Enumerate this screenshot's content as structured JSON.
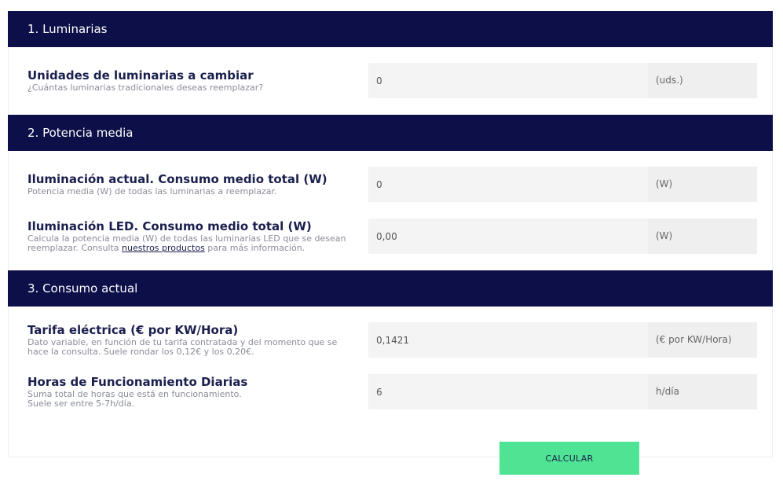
{
  "sections": [
    {
      "header": "1. Luminarias",
      "rows": [
        {
          "title": "Unidades de luminarias a cambiar",
          "description": "¿Cuántas luminarias tradicionales deseas reemplazar?",
          "value": "0",
          "unit": "(uds.)"
        }
      ]
    },
    {
      "header": "2. Potencia media",
      "rows": [
        {
          "title": "Iluminación actual. Consumo medio total (W)",
          "description": "Potencia media (W) de todas las luminarias a reemplazar.",
          "value": "0",
          "unit": "(W)"
        },
        {
          "title": "Iluminación LED. Consumo medio total (W)",
          "description_before": "Calcula la potencia media (W) de todas las luminarias LED que se desean reemplazar. Consulta ",
          "description_link": "nuestros productos",
          "description_after": " para más información.",
          "value": "0,00",
          "unit": "(W)"
        }
      ]
    },
    {
      "header": "3. Consumo actual",
      "rows": [
        {
          "title": "Tarifa eléctrica (€ por KW/Hora)",
          "description": "Dato variable, en función de tu tarifa contratada y del momento que se hace la consulta. Suele rondar los 0,12€ y los 0,20€.",
          "value": "0,1421",
          "unit": "(€ por KW/Hora)"
        },
        {
          "title": "Horas de Funcionamiento Diarias",
          "description_line1": "Suma total de horas que está en funcionamiento.",
          "description_line2": "Suele ser entre 5-7h/día.",
          "value": "6",
          "unit": "h/día"
        }
      ]
    }
  ],
  "button": {
    "label": "CALCULAR"
  },
  "colors": {
    "header_bg": "#0c0f48",
    "button_bg": "#4fe394"
  }
}
